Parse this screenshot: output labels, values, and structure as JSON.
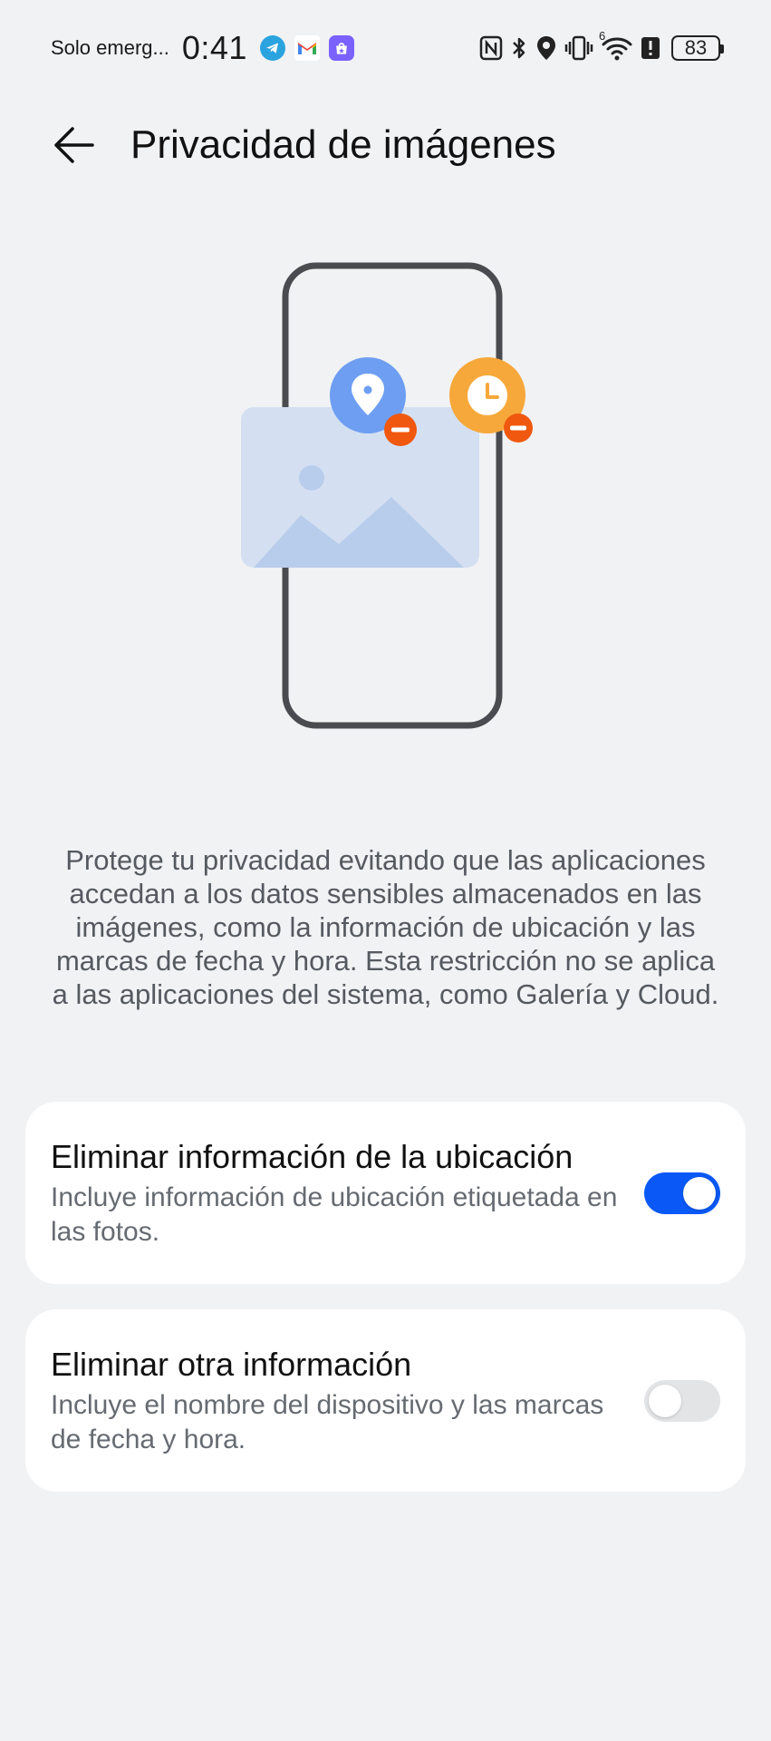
{
  "status_bar": {
    "carrier": "Solo emerg...",
    "time": "0:41",
    "notification_icons": [
      "telegram-icon",
      "gmail-icon",
      "store-icon"
    ],
    "system_icons": [
      "nfc-icon",
      "bluetooth-icon",
      "location-icon",
      "vibrate-icon",
      "wifi-icon",
      "alert-icon"
    ],
    "wifi_label": "6",
    "battery": "83"
  },
  "header": {
    "back_icon": "arrow-left-icon",
    "title": "Privacidad de imágenes"
  },
  "illustration": {
    "icons": [
      "phone-icon",
      "image-icon",
      "location-pin-icon",
      "clock-icon",
      "remove-icon"
    ],
    "colors": {
      "phone_frame": "#4a4b50",
      "photo": "#d4e0f2",
      "mountains": "#b8cdeb",
      "pin_badge": "#6d9ef2",
      "clock_badge": "#f7a83a",
      "remove": "#f0580f"
    }
  },
  "description": "Protege tu privacidad evitando que las aplicaciones accedan a los datos sensibles almacenados en las imágenes, como la información de ubicación y las marcas de fecha y hora. Esta restricción no se aplica a las aplicaciones del sistema, como Galería y Cloud.",
  "settings": [
    {
      "title": "Eliminar información de la ubicación",
      "subtitle": "Incluye información de ubicación etiquetada en las fotos.",
      "enabled": true
    },
    {
      "title": "Eliminar otra información",
      "subtitle": "Incluye el nombre del dispositivo y las marcas de fecha y hora.",
      "enabled": false
    }
  ],
  "colors": {
    "background": "#f1f2f4",
    "card": "#ffffff",
    "accent": "#0a59f7",
    "toggle_off": "#e3e4e6"
  }
}
